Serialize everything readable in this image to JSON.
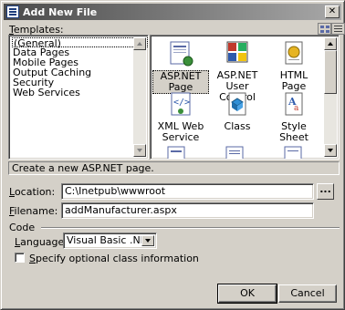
{
  "window": {
    "title": "Add New File"
  },
  "labels": {
    "templates_first": "T",
    "templates_rest": "emplates:",
    "location_first": "L",
    "location_rest": "ocation:",
    "filename_first": "F",
    "filename_rest": "ilename:",
    "code": "Code",
    "language_first": "L",
    "language_rest": "anguage:",
    "specify_first": "S",
    "specify_rest": "pecify optional class information"
  },
  "categories": [
    {
      "label": "(General)",
      "selected": true
    },
    {
      "label": "Data Pages"
    },
    {
      "label": "Mobile Pages"
    },
    {
      "label": "Output Caching"
    },
    {
      "label": "Security"
    },
    {
      "label": "Web Services"
    }
  ],
  "templates": [
    {
      "label": "ASP.NET Page",
      "icon": "aspnet-page-icon",
      "selected": true
    },
    {
      "label": "ASP.NET User Control",
      "icon": "user-control-icon"
    },
    {
      "label": "HTML Page",
      "icon": "html-page-icon"
    },
    {
      "label": "XML Web Service",
      "icon": "web-service-icon"
    },
    {
      "label": "Class",
      "icon": "class-icon"
    },
    {
      "label": "Style Sheet",
      "icon": "style-sheet-icon"
    }
  ],
  "description": "Create a new ASP.NET page.",
  "fields": {
    "location": "C:\\Inetpub\\wwwroot",
    "filename": "addManufacturer.aspx",
    "browse_label": "..."
  },
  "language": {
    "selected": "Visual Basic .NET"
  },
  "specify_class": {
    "checked": false
  },
  "buttons": {
    "ok": "OK",
    "cancel": "Cancel"
  },
  "colors": {
    "selection_accent": "#0a246a"
  }
}
